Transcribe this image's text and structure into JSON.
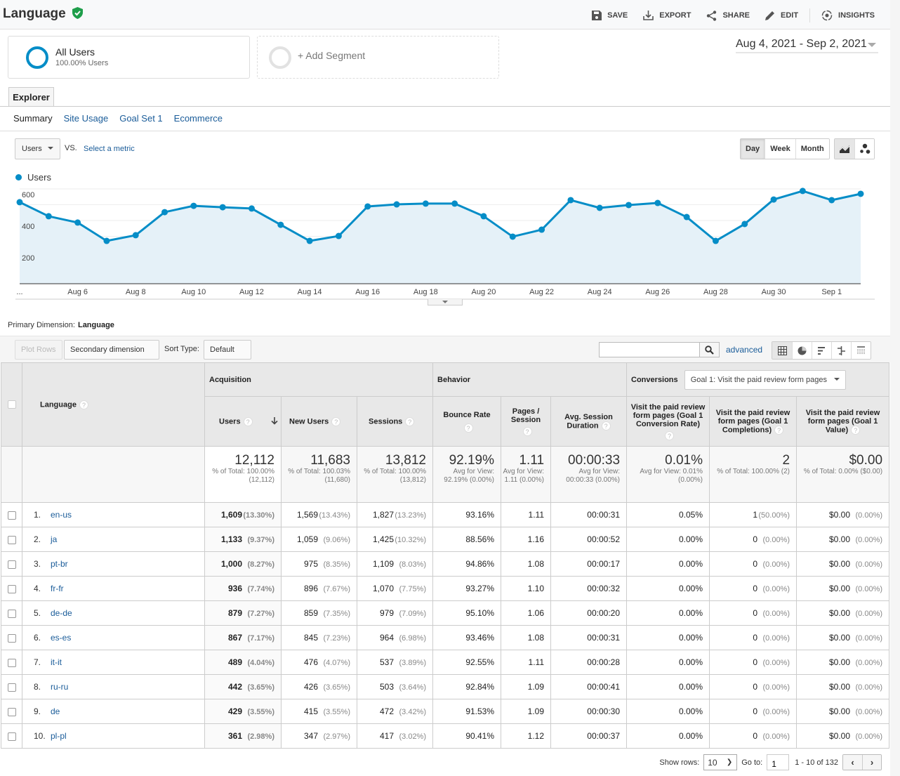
{
  "header": {
    "title": "Language",
    "actions": [
      {
        "id": "save",
        "label": "SAVE",
        "icon": "save-icon"
      },
      {
        "id": "export",
        "label": "EXPORT",
        "icon": "export-icon"
      },
      {
        "id": "share",
        "label": "SHARE",
        "icon": "share-icon"
      },
      {
        "id": "edit",
        "label": "EDIT",
        "icon": "edit-icon"
      },
      {
        "id": "insights",
        "label": "INSIGHTS",
        "icon": "insights-icon"
      }
    ]
  },
  "segments": {
    "active": {
      "name": "All Users",
      "sub": "100.00% Users"
    },
    "add_label": "+ Add Segment"
  },
  "date_range": "Aug 4, 2021 - Sep 2, 2021",
  "explorer": {
    "tab": "Explorer",
    "subtabs": [
      "Summary",
      "Site Usage",
      "Goal Set 1",
      "Ecommerce"
    ],
    "active_subtab": "Summary"
  },
  "chart_controls": {
    "metric": "Users",
    "vs": "VS.",
    "select_metric": "Select a metric",
    "periods": [
      "Day",
      "Week",
      "Month"
    ],
    "active_period": "Day"
  },
  "chart_data": {
    "type": "area",
    "series": [
      {
        "name": "Users",
        "color": "#058dc7",
        "values": [
          516,
          427,
          387,
          271,
          307,
          453,
          493,
          484,
          476,
          373,
          271,
          302,
          489,
          502,
          507,
          507,
          427,
          298,
          342,
          529,
          480,
          498,
          511,
          422,
          271,
          378,
          533,
          587,
          529,
          569
        ]
      }
    ],
    "x": [
      "Aug 4",
      "Aug 5",
      "Aug 6",
      "Aug 7",
      "Aug 8",
      "Aug 9",
      "Aug 10",
      "Aug 11",
      "Aug 12",
      "Aug 13",
      "Aug 14",
      "Aug 15",
      "Aug 16",
      "Aug 17",
      "Aug 18",
      "Aug 19",
      "Aug 20",
      "Aug 21",
      "Aug 22",
      "Aug 23",
      "Aug 24",
      "Aug 25",
      "Aug 26",
      "Aug 27",
      "Aug 28",
      "Aug 29",
      "Aug 30",
      "Aug 31",
      "Sep 1",
      "Sep 2"
    ],
    "x_tick_labels": [
      "...",
      "Aug 6",
      "Aug 8",
      "Aug 10",
      "Aug 12",
      "Aug 14",
      "Aug 16",
      "Aug 18",
      "Aug 20",
      "Aug 22",
      "Aug 24",
      "Aug 26",
      "Aug 28",
      "Aug 30",
      "Sep 1"
    ],
    "y_ticks": [
      200,
      400,
      600
    ],
    "ylim": [
      0,
      700
    ],
    "grid": true,
    "legend": "top-left",
    "title": "",
    "xlabel": "",
    "ylabel": ""
  },
  "table_toolbar": {
    "primary_dimension_label": "Primary Dimension:",
    "primary_dimension": "Language",
    "plot_rows": "Plot Rows",
    "secondary_dimension": "Secondary dimension",
    "sort_type_label": "Sort Type:",
    "sort_type": "Default",
    "search_value": "",
    "advanced": "advanced"
  },
  "table": {
    "dimension_header": "Language",
    "groups": {
      "acquisition": "Acquisition",
      "behavior": "Behavior",
      "conversions": "Conversions"
    },
    "goal_select": "Goal 1: Visit the paid review form pages",
    "columns": [
      "Users",
      "New Users",
      "Sessions",
      "Bounce Rate",
      "Pages / Session",
      "Avg. Session Duration",
      "Visit the paid review form pages (Goal 1 Conversion Rate)",
      "Visit the paid review form pages (Goal 1 Completions)",
      "Visit the paid review form pages (Goal 1 Value)"
    ],
    "totals": [
      {
        "main": "12,112",
        "sub": "% of Total: 100.00% (12,112)"
      },
      {
        "main": "11,683",
        "sub": "% of Total: 100.03% (11,680)"
      },
      {
        "main": "13,812",
        "sub": "% of Total: 100.00% (13,812)"
      },
      {
        "main": "92.19%",
        "sub": "Avg for View: 92.19% (0.00%)"
      },
      {
        "main": "1.11",
        "sub": "Avg for View: 1.11 (0.00%)"
      },
      {
        "main": "00:00:33",
        "sub": "Avg for View: 00:00:33 (0.00%)"
      },
      {
        "main": "0.01%",
        "sub": "Avg for View: 0.01% (0.00%)"
      },
      {
        "main": "2",
        "sub": "% of Total: 100.00% (2)"
      },
      {
        "main": "$0.00",
        "sub": "% of Total: 0.00% ($0.00)"
      }
    ],
    "rows": [
      {
        "rank": "1.",
        "language": "en-us",
        "users": "1,609",
        "users_pct": "(13.30%)",
        "new_users": "1,569",
        "new_users_pct": "(13.43%)",
        "sessions": "1,827",
        "sessions_pct": "(13.23%)",
        "bounce": "93.16%",
        "pages": "1.11",
        "duration": "00:00:31",
        "conv_rate": "0.05%",
        "completions": "1",
        "completions_pct": "(50.00%)",
        "value": "$0.00",
        "value_pct": "(0.00%)"
      },
      {
        "rank": "2.",
        "language": "ja",
        "users": "1,133",
        "users_pct": "(9.37%)",
        "new_users": "1,059",
        "new_users_pct": "(9.06%)",
        "sessions": "1,425",
        "sessions_pct": "(10.32%)",
        "bounce": "88.56%",
        "pages": "1.16",
        "duration": "00:00:52",
        "conv_rate": "0.00%",
        "completions": "0",
        "completions_pct": "(0.00%)",
        "value": "$0.00",
        "value_pct": "(0.00%)"
      },
      {
        "rank": "3.",
        "language": "pt-br",
        "users": "1,000",
        "users_pct": "(8.27%)",
        "new_users": "975",
        "new_users_pct": "(8.35%)",
        "sessions": "1,109",
        "sessions_pct": "(8.03%)",
        "bounce": "94.86%",
        "pages": "1.08",
        "duration": "00:00:17",
        "conv_rate": "0.00%",
        "completions": "0",
        "completions_pct": "(0.00%)",
        "value": "$0.00",
        "value_pct": "(0.00%)"
      },
      {
        "rank": "4.",
        "language": "fr-fr",
        "users": "936",
        "users_pct": "(7.74%)",
        "new_users": "896",
        "new_users_pct": "(7.67%)",
        "sessions": "1,070",
        "sessions_pct": "(7.75%)",
        "bounce": "93.27%",
        "pages": "1.10",
        "duration": "00:00:32",
        "conv_rate": "0.00%",
        "completions": "0",
        "completions_pct": "(0.00%)",
        "value": "$0.00",
        "value_pct": "(0.00%)"
      },
      {
        "rank": "5.",
        "language": "de-de",
        "users": "879",
        "users_pct": "(7.27%)",
        "new_users": "859",
        "new_users_pct": "(7.35%)",
        "sessions": "979",
        "sessions_pct": "(7.09%)",
        "bounce": "95.10%",
        "pages": "1.06",
        "duration": "00:00:20",
        "conv_rate": "0.00%",
        "completions": "0",
        "completions_pct": "(0.00%)",
        "value": "$0.00",
        "value_pct": "(0.00%)"
      },
      {
        "rank": "6.",
        "language": "es-es",
        "users": "867",
        "users_pct": "(7.17%)",
        "new_users": "845",
        "new_users_pct": "(7.23%)",
        "sessions": "964",
        "sessions_pct": "(6.98%)",
        "bounce": "93.46%",
        "pages": "1.08",
        "duration": "00:00:31",
        "conv_rate": "0.00%",
        "completions": "0",
        "completions_pct": "(0.00%)",
        "value": "$0.00",
        "value_pct": "(0.00%)"
      },
      {
        "rank": "7.",
        "language": "it-it",
        "users": "489",
        "users_pct": "(4.04%)",
        "new_users": "476",
        "new_users_pct": "(4.07%)",
        "sessions": "537",
        "sessions_pct": "(3.89%)",
        "bounce": "92.55%",
        "pages": "1.11",
        "duration": "00:00:28",
        "conv_rate": "0.00%",
        "completions": "0",
        "completions_pct": "(0.00%)",
        "value": "$0.00",
        "value_pct": "(0.00%)"
      },
      {
        "rank": "8.",
        "language": "ru-ru",
        "users": "442",
        "users_pct": "(3.65%)",
        "new_users": "426",
        "new_users_pct": "(3.65%)",
        "sessions": "503",
        "sessions_pct": "(3.64%)",
        "bounce": "92.84%",
        "pages": "1.09",
        "duration": "00:00:41",
        "conv_rate": "0.00%",
        "completions": "0",
        "completions_pct": "(0.00%)",
        "value": "$0.00",
        "value_pct": "(0.00%)"
      },
      {
        "rank": "9.",
        "language": "de",
        "users": "429",
        "users_pct": "(3.55%)",
        "new_users": "415",
        "new_users_pct": "(3.55%)",
        "sessions": "472",
        "sessions_pct": "(3.42%)",
        "bounce": "91.53%",
        "pages": "1.09",
        "duration": "00:00:30",
        "conv_rate": "0.00%",
        "completions": "0",
        "completions_pct": "(0.00%)",
        "value": "$0.00",
        "value_pct": "(0.00%)"
      },
      {
        "rank": "10.",
        "language": "pl-pl",
        "users": "361",
        "users_pct": "(2.98%)",
        "new_users": "347",
        "new_users_pct": "(2.97%)",
        "sessions": "417",
        "sessions_pct": "(3.02%)",
        "bounce": "90.41%",
        "pages": "1.12",
        "duration": "00:00:37",
        "conv_rate": "0.00%",
        "completions": "0",
        "completions_pct": "(0.00%)",
        "value": "$0.00",
        "value_pct": "(0.00%)"
      }
    ]
  },
  "pagination": {
    "show_rows_label": "Show rows:",
    "show_rows": "10",
    "goto_label": "Go to:",
    "goto_value": "1",
    "range": "1 - 10 of 132"
  }
}
